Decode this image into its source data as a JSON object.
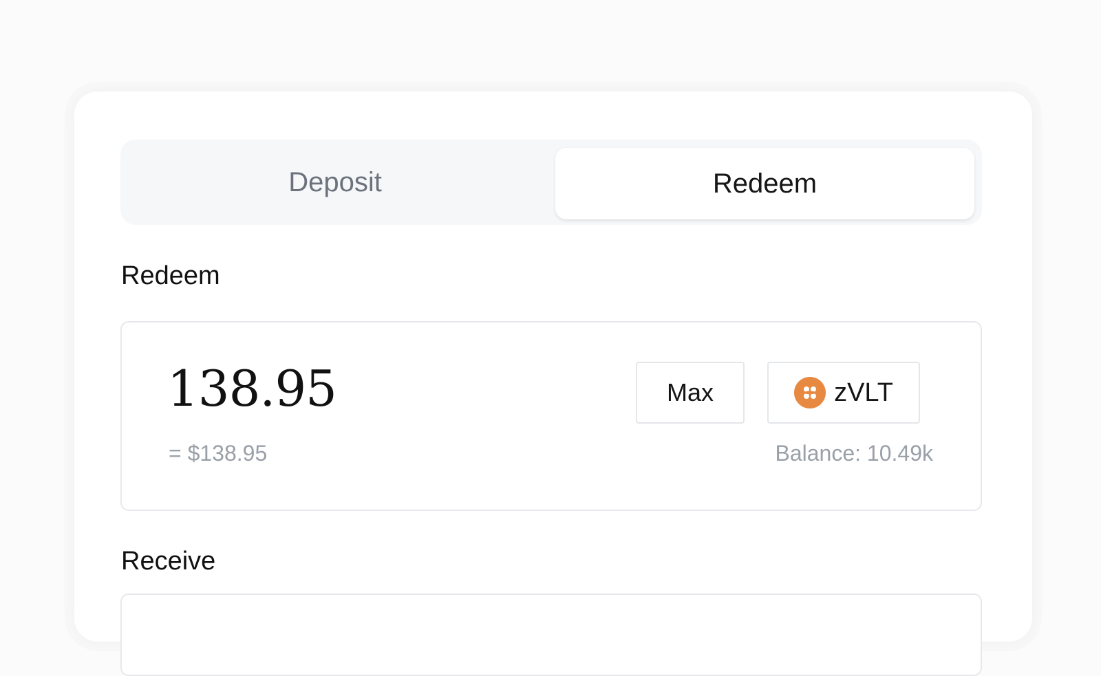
{
  "tabs": [
    {
      "label": "Deposit",
      "active": false
    },
    {
      "label": "Redeem",
      "active": true
    }
  ],
  "redeem_section": {
    "label": "Redeem",
    "amount": "138.95",
    "usd_value": "= $138.95",
    "max_label": "Max",
    "token": {
      "symbol": "zVLT",
      "icon": "zvlt-token-icon",
      "icon_color": "#e88941"
    },
    "balance": "Balance: 10.49k"
  },
  "receive_section": {
    "label": "Receive"
  },
  "colors": {
    "background": "#fbfbfc",
    "card": "#ffffff",
    "tab_track": "#f6f7f9",
    "text_primary": "#111111",
    "text_muted": "#9aa0a8"
  }
}
